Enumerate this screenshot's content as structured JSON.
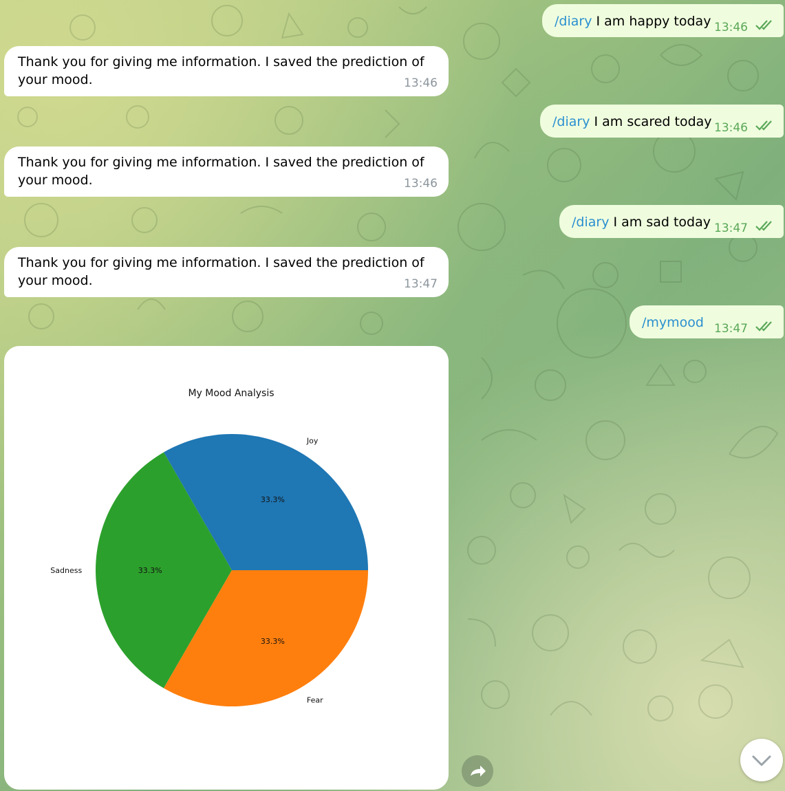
{
  "messages": [
    {
      "dir": "out",
      "cmd": "/diary",
      "text": " I am happy today",
      "time": "13:46"
    },
    {
      "dir": "in",
      "text": "Thank you for giving me information. I saved the prediction of your mood.",
      "time": "13:46"
    },
    {
      "dir": "out",
      "cmd": "/diary",
      "text": " I am scared today",
      "time": "13:46"
    },
    {
      "dir": "in",
      "text": "Thank you for giving me information. I saved the prediction of your mood.",
      "time": "13:46"
    },
    {
      "dir": "out",
      "cmd": "/diary",
      "text": " I am sad today",
      "time": "13:47"
    },
    {
      "dir": "in",
      "text": "Thank you for giving me information. I saved the prediction of your mood.",
      "time": "13:47"
    },
    {
      "dir": "out",
      "cmd": "/mymood",
      "text": "",
      "time": "13:47"
    }
  ],
  "icons": {
    "read_ticks": "double-check-icon",
    "forward": "share-forward-icon",
    "scroll_down": "chevron-down-icon"
  },
  "colors": {
    "outgoing_bubble": "#effdde",
    "incoming_bubble": "#ffffff",
    "command_link": "#2b8fd0",
    "outgoing_time": "#5aa758",
    "incoming_time": "#8c959c"
  },
  "chart_data": {
    "type": "pie",
    "title": "My Mood Analysis",
    "slices": [
      {
        "label": "Joy",
        "value": 33.3,
        "pct_label": "33.3%",
        "color": "#1f77b4"
      },
      {
        "label": "Sadness",
        "value": 33.3,
        "pct_label": "33.3%",
        "color": "#2ca02c"
      },
      {
        "label": "Fear",
        "value": 33.3,
        "pct_label": "33.3%",
        "color": "#ff7f0e"
      }
    ]
  }
}
